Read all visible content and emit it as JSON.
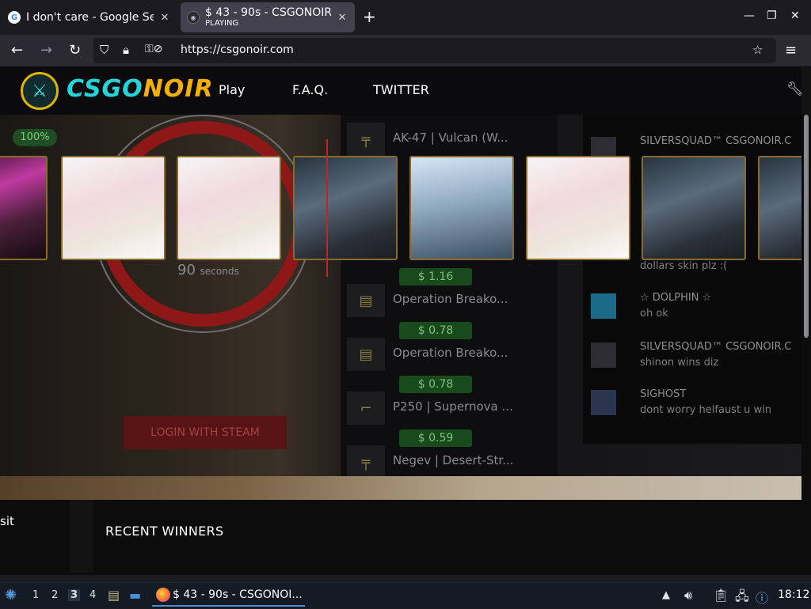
{
  "browser": {
    "tabs": [
      {
        "title": "I don't care - Google Sea",
        "icon": "google-icon"
      },
      {
        "title": "$ 43 - 90s - CSGONOIR -",
        "subtitle": "PLAYING",
        "icon": "csgonoir-favicon"
      }
    ],
    "url": "https://csgonoir.com"
  },
  "site": {
    "brand_part1": "CSGO",
    "brand_part2": "NOIR",
    "menu": [
      "Play",
      "F.A.Q.",
      "TWITTER"
    ],
    "progress_label": "100%",
    "timer_value": "90",
    "timer_unit": "seconds",
    "login_label": "LOGIN WITH STEAM",
    "deposit_fragment": "sit",
    "recent_winners_label": "RECENT WINNERS",
    "items": [
      {
        "name": "AK-47 | Vulcan (W...",
        "price": null
      },
      {
        "name": "Operation Breako...",
        "price": "$ 1.16"
      },
      {
        "name": "Operation Breako...",
        "price": "$ 0.78"
      },
      {
        "name": "P250 | Supernova ...",
        "price": "$ 0.78"
      },
      {
        "name": "Negev | Desert-Str...",
        "price": "$ 0.59"
      }
    ],
    "chat": [
      {
        "name": "SILVERSQUAD™ CSGONOIR.C",
        "message": ""
      },
      {
        "name": "☆ DOLPHIN ☆",
        "message": "oh ok"
      },
      {
        "name": "SILVERSQUAD™ CSGONOIR.C",
        "message": "shinon wins diz"
      },
      {
        "name": "SIGHOST",
        "message": "dont worry helfaust u win"
      }
    ],
    "chat_partial": "dollars skin plz :("
  },
  "taskbar": {
    "workspaces": [
      "1",
      "2",
      "3",
      "4"
    ],
    "active_task": "$ 43 - 90s - CSGONOI...",
    "clock": "18:12"
  }
}
